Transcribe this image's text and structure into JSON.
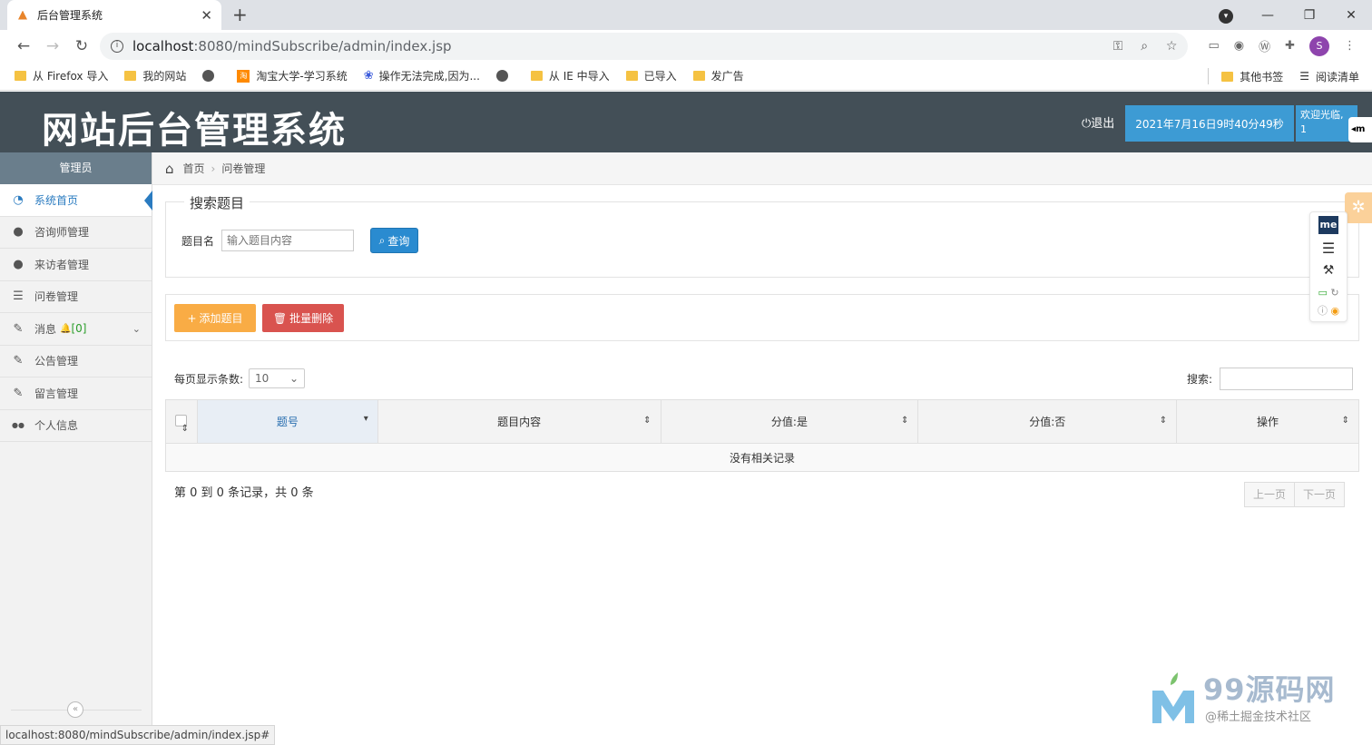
{
  "browser": {
    "tab_title": "后台管理系统",
    "tab_close": "✕",
    "new_tab": "+",
    "url_host": "localhost",
    "url_rest": ":8080/mindSubscribe/admin/index.jsp",
    "profile_initial": "S",
    "bookmarks": [
      {
        "label": "从 Firefox 导入",
        "icon": "folder-icon"
      },
      {
        "label": "我的网站",
        "icon": "folder-icon"
      },
      {
        "label": "",
        "icon": "globe-icon"
      },
      {
        "label": "淘宝大学-学习系统",
        "icon": "taobao-icon"
      },
      {
        "label": "操作无法完成,因为...",
        "icon": "baidu-paw-icon"
      },
      {
        "label": "",
        "icon": "globe-icon"
      },
      {
        "label": "从 IE 中导入",
        "icon": "folder-icon"
      },
      {
        "label": "已导入",
        "icon": "folder-icon"
      },
      {
        "label": "发广告",
        "icon": "folder-icon"
      }
    ],
    "bookmarks_other": "其他书签",
    "reading_list": "阅读清单",
    "status_url": "localhost:8080/mindSubscribe/admin/index.jsp#"
  },
  "header": {
    "title": "网站后台管理系统",
    "logout": "退出",
    "datetime": "2021年7月16日9时40分49秒",
    "welcome_line1": "欢迎光临,",
    "welcome_line2": "1"
  },
  "sidebar": {
    "heading": "管理员",
    "items": [
      {
        "label": "系统首页",
        "icon": "dashboard-icon",
        "active": true
      },
      {
        "label": "咨询师管理",
        "icon": "user-icon"
      },
      {
        "label": "来访者管理",
        "icon": "user-icon"
      },
      {
        "label": "问卷管理",
        "icon": "list-icon"
      },
      {
        "label": "消息",
        "badge": "[0]",
        "icon": "edit-icon"
      },
      {
        "label": "公告管理",
        "icon": "edit-icon"
      },
      {
        "label": "留言管理",
        "icon": "edit-icon"
      },
      {
        "label": "个人信息",
        "icon": "users-icon"
      }
    ],
    "collapse_label": "«"
  },
  "breadcrumb": {
    "home": "首页",
    "current": "问卷管理"
  },
  "search": {
    "legend": "搜索题目",
    "field_label": "题目名",
    "placeholder": "输入题目内容",
    "query_button": "查询"
  },
  "toolbar": {
    "add_label": "添加题目",
    "batch_delete_label": "批量删除"
  },
  "table": {
    "per_page_label": "每页显示条数:",
    "per_page_value": "10",
    "search_label": "搜索:",
    "columns": [
      "题号",
      "题目内容",
      "分值:是",
      "分值:否",
      "操作"
    ],
    "empty_text": "没有相关记录",
    "record_info": "第 0 到 0 条记录，共 0 条",
    "prev_page": "上一页",
    "next_page": "下一页"
  },
  "float_panel": {
    "me_label": "me"
  },
  "watermark": {
    "text": "99源码网",
    "sub": "@稀土掘金技术社区"
  },
  "colors": {
    "header_bg": "#434f57",
    "accent_blue": "#3d9bd4",
    "add_orange": "#f9ac45",
    "delete_red": "#d9534f"
  }
}
